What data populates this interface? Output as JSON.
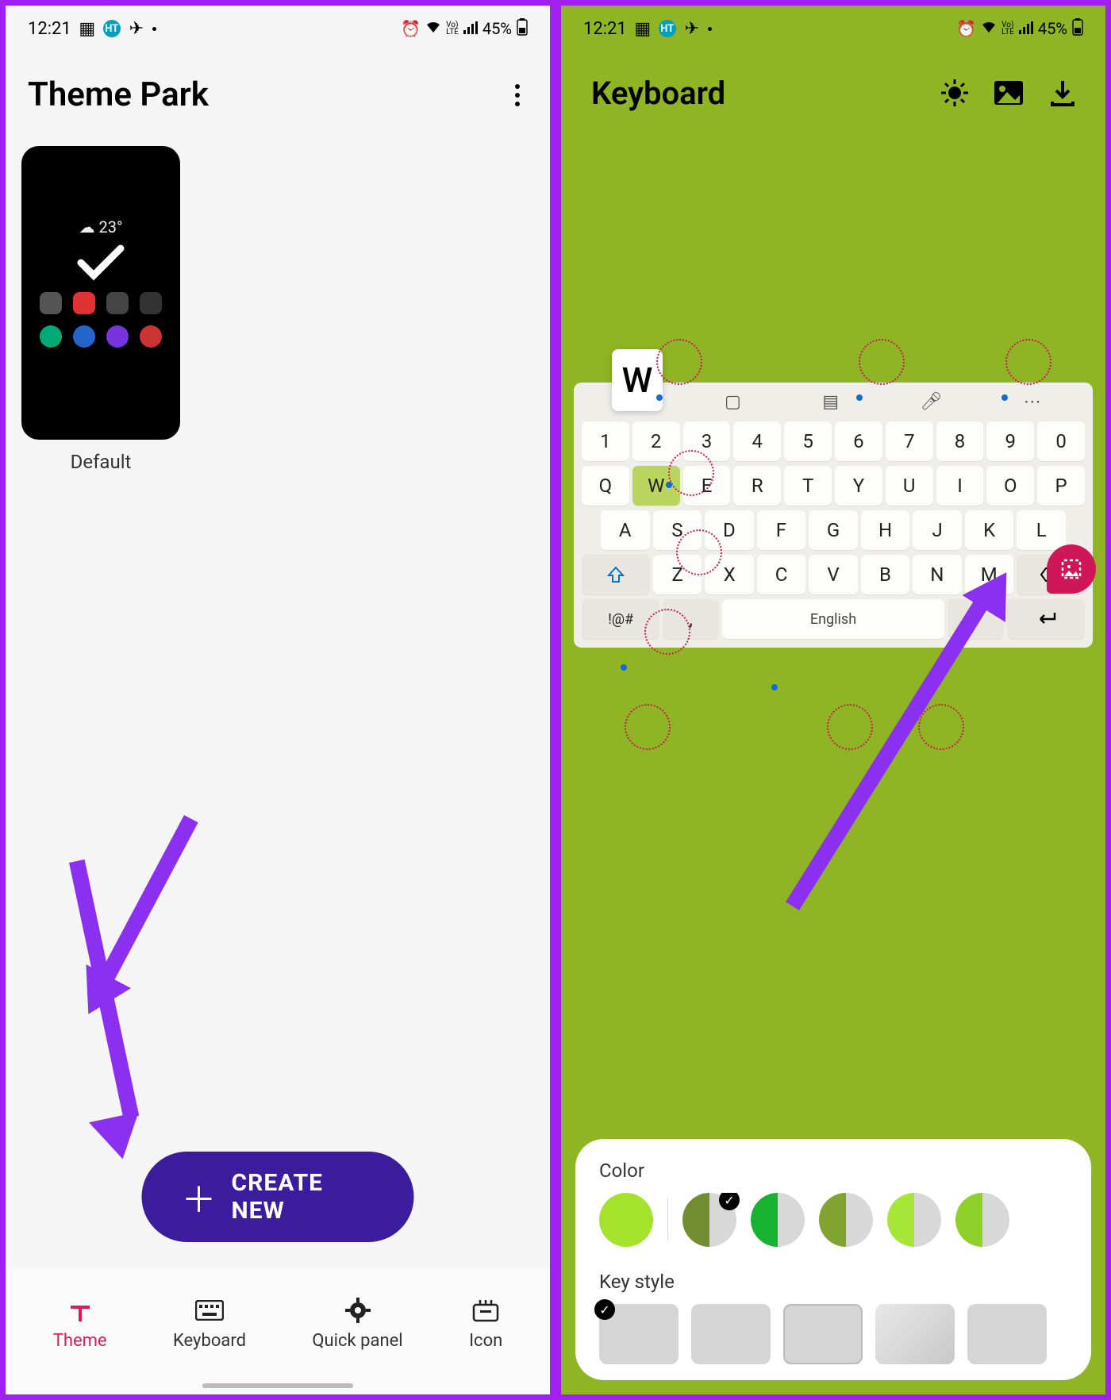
{
  "statusbar": {
    "time": "12:21",
    "battery_text": "45%"
  },
  "left": {
    "title": "Theme Park",
    "theme_default_label": "Default",
    "theme_weather": "23°",
    "create_button": "CREATE NEW",
    "tabs": {
      "theme": "Theme",
      "keyboard": "Keyboard",
      "quickpanel": "Quick panel",
      "icon": "Icon"
    }
  },
  "right": {
    "title": "Keyboard",
    "key_popup": "W",
    "space_label": "English",
    "symkey": "!@#",
    "color_label": "Color",
    "keystyle_label": "Key style",
    "colors": {
      "primary": "#a4e22b",
      "opt2a": "#738c2f",
      "opt2b": "#d8d8d8",
      "opt3a": "#17b22f",
      "opt3b": "#d8d8d8",
      "opt4a": "#81a32f",
      "opt4b": "#d8d8d8",
      "opt5a": "#a6e639",
      "opt5b": "#d8d8d8",
      "opt6a": "#8fd12a",
      "opt6b": "#d8d8d8"
    },
    "num_row": [
      "1",
      "2",
      "3",
      "4",
      "5",
      "6",
      "7",
      "8",
      "9",
      "0"
    ],
    "row1": [
      "Q",
      "W",
      "E",
      "R",
      "T",
      "Y",
      "U",
      "I",
      "O",
      "P"
    ],
    "row2": [
      "A",
      "S",
      "D",
      "F",
      "G",
      "H",
      "J",
      "K",
      "L"
    ],
    "row3": [
      "Z",
      "X",
      "C",
      "V",
      "B",
      "N",
      "M"
    ]
  }
}
